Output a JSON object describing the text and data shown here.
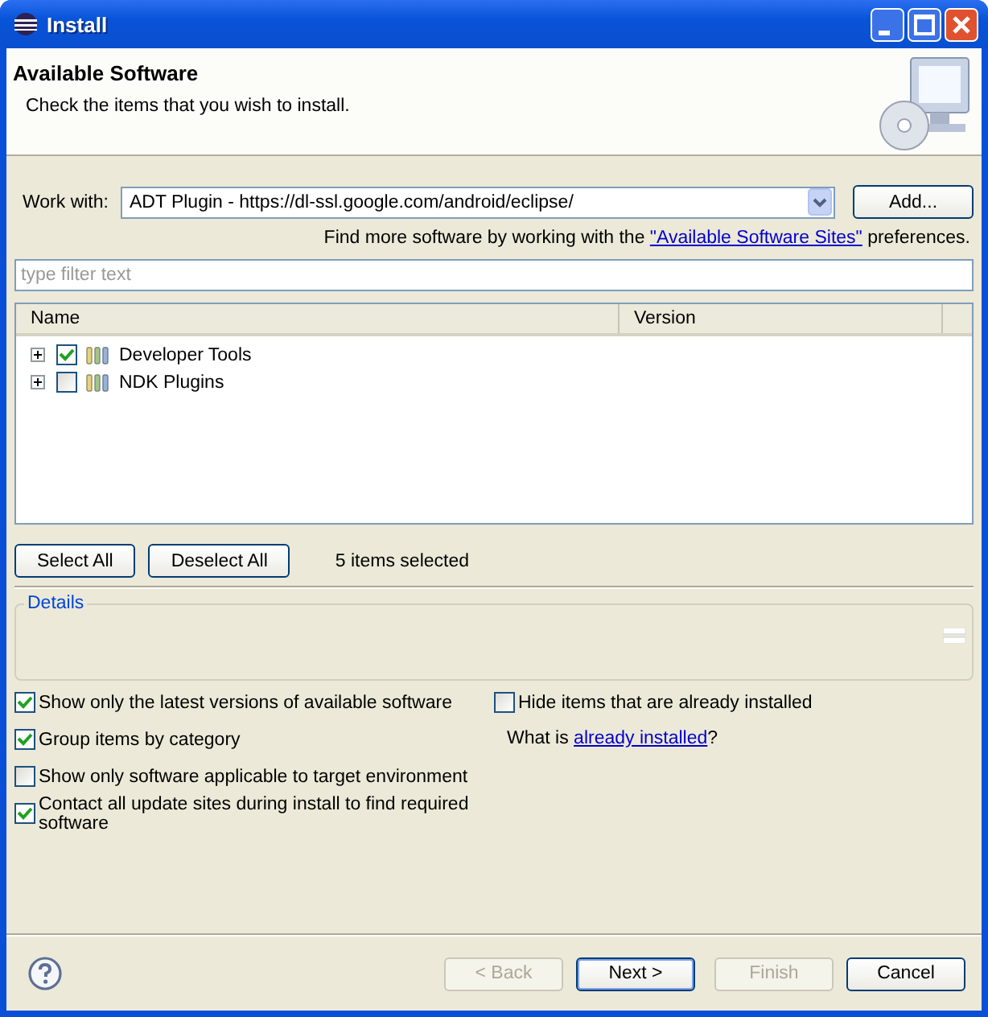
{
  "window": {
    "title": "Install"
  },
  "header": {
    "title": "Available Software",
    "description": "Check the items that you wish to install."
  },
  "work_with": {
    "label": "Work with:",
    "value": "ADT Plugin - https://dl-ssl.google.com/android/eclipse/",
    "button": "Add..."
  },
  "sites_hint": {
    "before": "Find more software by working with the",
    "link": "\"Available Software Sites\"",
    "after": "preferences."
  },
  "filter": {
    "placeholder": "type filter text"
  },
  "table": {
    "columns": [
      "Name",
      "Version"
    ],
    "rows": [
      {
        "name": "Developer Tools",
        "checked": true,
        "expanded": false
      },
      {
        "name": "NDK Plugins",
        "checked": false,
        "expanded": false
      }
    ]
  },
  "selection_buttons": [
    {
      "label": "Select All"
    },
    {
      "label": "Deselect All"
    }
  ],
  "selection_count": "5 items selected",
  "details": {
    "label": "Details"
  },
  "options_left": [
    {
      "label": "Show only the latest versions of available software",
      "checked": true
    },
    {
      "label": "Group items by category",
      "checked": true
    },
    {
      "label": "Show only software applicable to target environment",
      "checked": false
    },
    {
      "label": "Contact all update sites during install to find required software",
      "checked": true
    }
  ],
  "options_right": {
    "hide_installed": {
      "label": "Hide items that are already installed",
      "checked": false
    },
    "what_is": {
      "before": "What is",
      "link": "already installed",
      "after": "?"
    }
  },
  "footer_buttons": [
    {
      "label": "< Back",
      "disabled": true,
      "default": false
    },
    {
      "label": "Next >",
      "disabled": false,
      "default": true
    },
    {
      "label": "Finish",
      "disabled": true,
      "default": false
    },
    {
      "label": "Cancel",
      "disabled": false,
      "default": false
    }
  ]
}
